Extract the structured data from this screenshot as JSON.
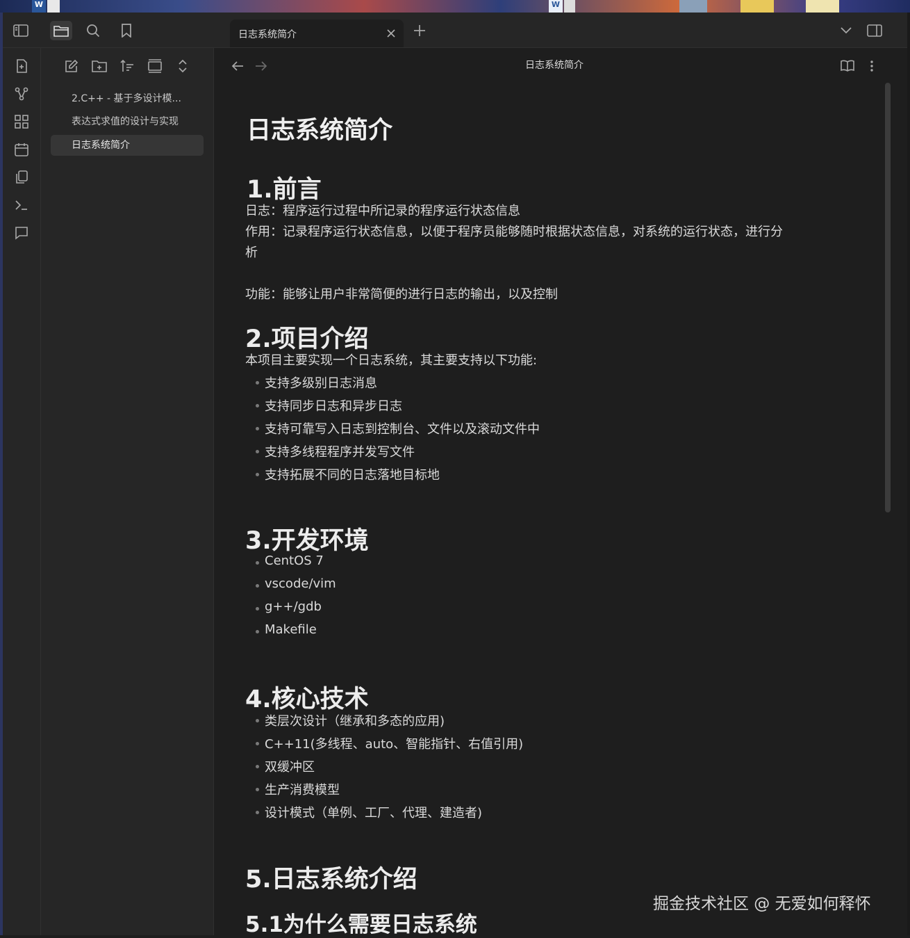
{
  "desktop": {
    "word_badge": "W"
  },
  "tab": {
    "title": "日志系统简介"
  },
  "file_list": [
    "2.C++ - 基于多设计模...",
    "表达式求值的设计与实现",
    "日志系统简介"
  ],
  "view": {
    "title": "日志系统简介"
  },
  "doc": {
    "title": "日志系统简介",
    "s1": {
      "heading": "1.前言",
      "p1": "日志：程序运行过程中所记录的程序运行状态信息",
      "p2a": "作用：记录程序运行状态信息，以便于程序员能够随时根据状态信息，对系统的运行状态，进行分",
      "p2b": "析",
      "p3": "功能：能够让用户非常简便的进行日志的输出，以及控制"
    },
    "s2": {
      "heading": "2.项目介绍",
      "intro": "本项目主要实现一个日志系统，其主要支持以下功能:",
      "items": [
        "支持多级别日志消息",
        "支持同步日志和异步日志",
        "支持可靠写入日志到控制台、文件以及滚动文件中",
        "支持多线程程序并发写文件",
        "支持拓展不同的日志落地目标地"
      ]
    },
    "s3": {
      "heading": "3.开发环境",
      "items": [
        "CentOS 7",
        "vscode/vim",
        "g++/gdb",
        "Makefile"
      ]
    },
    "s4": {
      "heading": "4.核心技术",
      "items": [
        "类层次设计（继承和多态的应用)",
        "C++11(多线程、auto、智能指针、右值引用)",
        "双缓冲区",
        "生产消费模型",
        "设计模式（单例、工厂、代理、建造者)"
      ]
    },
    "s5": {
      "heading": "5.日志系统介绍",
      "sub": "5.1为什么需要日志系统"
    }
  },
  "watermark": "掘金技术社区 @ 无爱如何释怀"
}
